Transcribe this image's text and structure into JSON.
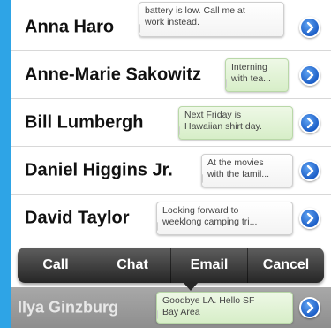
{
  "contacts": [
    {
      "name": "Anna Haro",
      "message_line1": "battery is low. Call me at",
      "message_line2": "work instead.",
      "bubble": "white"
    },
    {
      "name": "Anne-Marie Sakowitz",
      "message_line1": "Interning",
      "message_line2": "with tea...",
      "bubble": "green"
    },
    {
      "name": "Bill Lumbergh",
      "message_line1": "Next Friday is",
      "message_line2": "Hawaiian shirt day.",
      "bubble": "green"
    },
    {
      "name": "Daniel Higgins Jr.",
      "message_line1": "At the movies",
      "message_line2": "with the famil...",
      "bubble": "white"
    },
    {
      "name": "David Taylor",
      "message_line1": "Looking forward to",
      "message_line2": "weeklong camping tri...",
      "bubble": "white"
    }
  ],
  "actions": {
    "call": "Call",
    "chat": "Chat",
    "email": "Email",
    "cancel": "Cancel"
  },
  "selected": {
    "name": "Ilya Ginzburg",
    "message_line1": "Goodbye LA. Hello SF",
    "message_line2": "Bay Area",
    "bubble": "green"
  },
  "icons": {
    "detail": "chevron-right-icon"
  },
  "colors": {
    "frame": "#2ea4e6",
    "detail_button": "#1d5fc7",
    "green_bubble": "#d7eec8"
  }
}
